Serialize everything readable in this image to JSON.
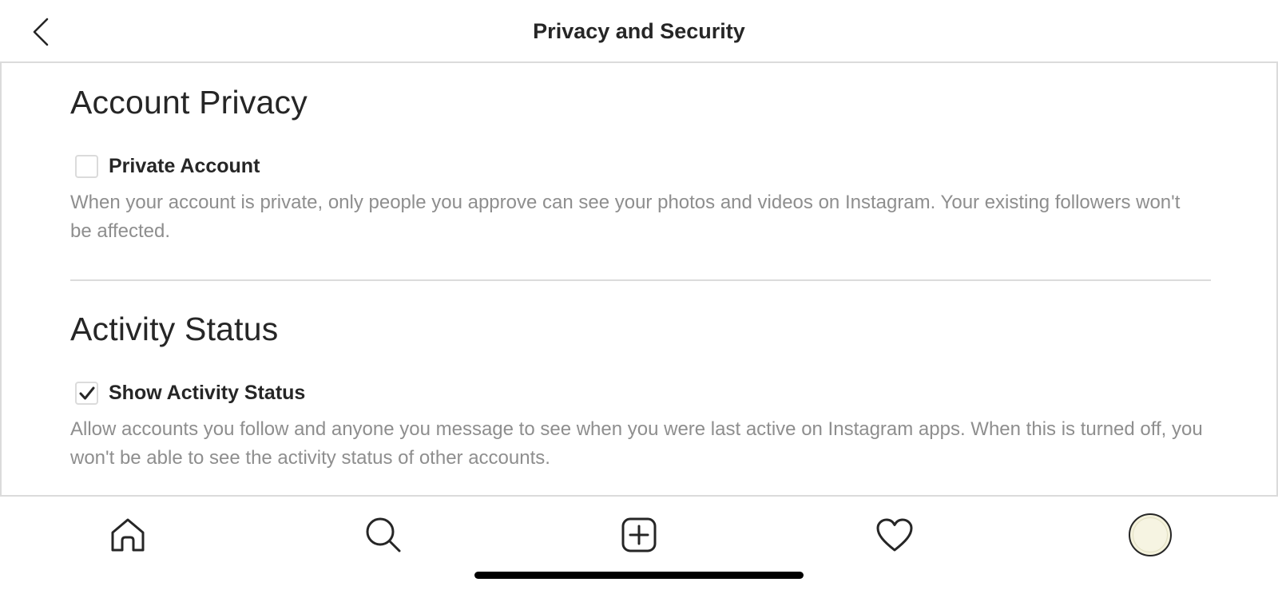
{
  "header": {
    "title": "Privacy and Security",
    "back_icon": "chevron-left-icon"
  },
  "account_privacy": {
    "title": "Account Privacy",
    "option_label": "Private Account",
    "checked": false,
    "description": "When your account is private, only people you approve can see your photos and videos on Instagram. Your existing followers won't be affected."
  },
  "activity_status": {
    "title": "Activity Status",
    "option_label": "Show Activity Status",
    "checked": true,
    "description": "Allow accounts you follow and anyone you message to see when you were last active on Instagram apps. When this is turned off, you won't be able to see the activity status of other accounts."
  },
  "tabbar": {
    "items": [
      {
        "icon": "home-icon"
      },
      {
        "icon": "search-icon"
      },
      {
        "icon": "new-post-icon"
      },
      {
        "icon": "heart-icon"
      },
      {
        "icon": "profile-avatar"
      }
    ]
  },
  "colors": {
    "text_primary": "#262626",
    "text_secondary": "#8e8e8e",
    "border": "#dbdbdb"
  }
}
